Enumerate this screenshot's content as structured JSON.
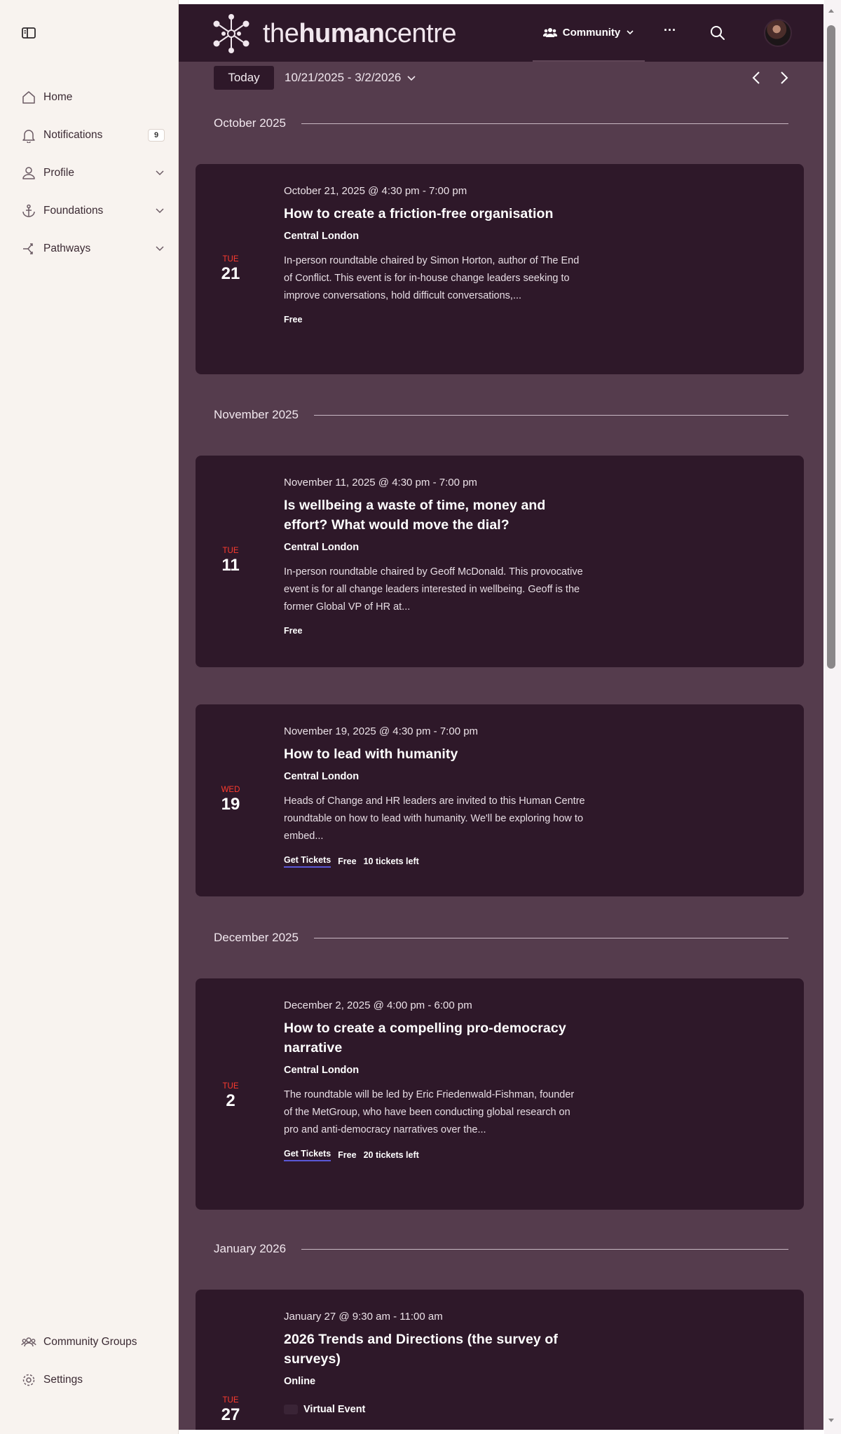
{
  "sidebar": {
    "toggle_icon": "sidebar-toggle-icon",
    "items": [
      {
        "label": "Home",
        "icon": "home-icon"
      },
      {
        "label": "Notifications",
        "icon": "bell-icon",
        "badge": "9"
      },
      {
        "label": "Profile",
        "icon": "user-icon"
      },
      {
        "label": "Foundations",
        "icon": "anchor-icon"
      },
      {
        "label": "Pathways",
        "icon": "pathways-icon"
      }
    ],
    "bottom_items": [
      {
        "label": "Community Groups",
        "icon": "groups-icon"
      },
      {
        "label": "Settings",
        "icon": "gear-icon"
      }
    ]
  },
  "header": {
    "logo_prefix": "the",
    "logo_bold": "human",
    "logo_suffix": "centre",
    "community_label": "Community",
    "more_label": "···"
  },
  "datebar": {
    "today_label": "Today",
    "range_label": "10/21/2025 - 3/2/2026"
  },
  "months": [
    "October 2025",
    "November 2025",
    "December 2025",
    "January 2026"
  ],
  "events": [
    {
      "dow": "TUE",
      "day": "21",
      "when": "October 21, 2025 @ 4:30 pm - 7:00 pm",
      "title": "How to create a friction-free organisation",
      "venue": "Central London",
      "desc": "In-person roundtable chaired by Simon Horton, author of The End of Conflict. This event is for in-house change leaders seeking to improve conversations, hold difficult conversations,...",
      "price": "Free"
    },
    {
      "dow": "TUE",
      "day": "11",
      "when": "November 11, 2025 @ 4:30 pm - 7:00 pm",
      "title": "Is wellbeing a waste of time, money and effort? What would move the dial?",
      "venue": "Central London",
      "desc": "In-person roundtable chaired by Geoff McDonald. This provocative event is for all change leaders interested in wellbeing. Geoff is the former Global VP of HR at...",
      "price": "Free"
    },
    {
      "dow": "WED",
      "day": "19",
      "when": "November 19, 2025 @ 4:30 pm - 7:00 pm",
      "title": "How to lead with humanity",
      "venue": "Central London",
      "desc": "Heads of Change and HR leaders are invited to this Human Centre roundtable on how to lead with humanity. We'll be exploring how to embed...",
      "tickets": "Get Tickets",
      "price": "Free",
      "left": "10 tickets left"
    },
    {
      "dow": "TUE",
      "day": "2",
      "when": "December 2, 2025 @ 4:00 pm - 6:00 pm",
      "title": "How to create a compelling pro-democracy narrative",
      "venue": "Central London",
      "desc": "The roundtable will be led by Eric Friedenwald-Fishman, founder of the MetGroup, who have been conducting global research on pro and anti-democracy narratives over the...",
      "tickets": "Get Tickets",
      "price": "Free",
      "left": "20 tickets left"
    },
    {
      "dow": "TUE",
      "day": "27",
      "when": "January 27 @ 9:30 am - 11:00 am",
      "title": "2026 Trends and Directions (the survey of surveys)",
      "venue": "Online",
      "virtual": "Virtual Event"
    }
  ],
  "colors": {
    "sidebar_bg": "#f8f3ef",
    "main_bg": "#553c4d",
    "card_bg": "#2e1829",
    "dow_red": "#ff3b2e",
    "ticket_underline": "#5a57d6"
  }
}
